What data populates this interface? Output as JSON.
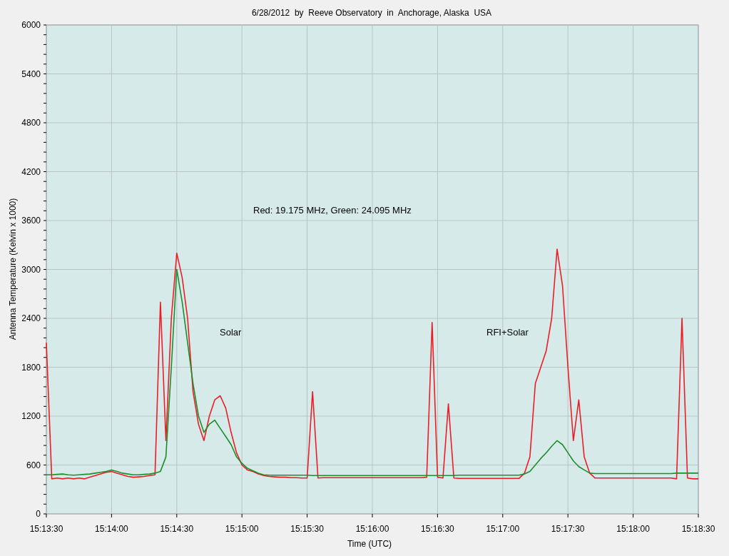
{
  "chart_data": {
    "type": "line",
    "grid": true,
    "title": "6/28/2012  by  Reeve Observatory  in  Anchorage, Alaska  USA",
    "xlabel": "Time (UTC)",
    "ylabel": "Antenna Temperature (Kelvin x 1000)",
    "categories": [
      "15:13:30",
      null,
      null,
      null,
      null,
      null,
      null,
      null,
      null,
      null,
      null,
      null,
      "15:14:00",
      null,
      null,
      null,
      null,
      null,
      null,
      null,
      null,
      null,
      null,
      null,
      "15:14:30",
      null,
      null,
      null,
      null,
      null,
      null,
      null,
      null,
      null,
      null,
      null,
      "15:15:00",
      null,
      null,
      null,
      null,
      null,
      null,
      null,
      null,
      null,
      null,
      null,
      "15:15:30",
      null,
      null,
      null,
      null,
      null,
      null,
      null,
      null,
      null,
      null,
      null,
      "15:16:00",
      null,
      null,
      null,
      null,
      null,
      null,
      null,
      null,
      null,
      null,
      null,
      "15:16:30",
      null,
      null,
      null,
      null,
      null,
      null,
      null,
      null,
      null,
      null,
      null,
      "15:17:00",
      null,
      null,
      null,
      null,
      null,
      null,
      null,
      null,
      null,
      null,
      null,
      "15:17:30",
      null,
      null,
      null,
      null,
      null,
      null,
      null,
      null,
      null,
      null,
      null,
      "15:18:00",
      null,
      null,
      null,
      null,
      null,
      null,
      null,
      null,
      null,
      null,
      null,
      "15:18:30"
    ],
    "series": [
      {
        "color": "#ee1c25",
        "values": [
          2100,
          430,
          440,
          430,
          440,
          430,
          440,
          430,
          450,
          470,
          490,
          510,
          520,
          500,
          480,
          460,
          450,
          455,
          460,
          470,
          480,
          2600,
          900,
          2400,
          3200,
          2900,
          2400,
          1500,
          1100,
          900,
          1200,
          1400,
          1450,
          1300,
          1000,
          750,
          600,
          540,
          520,
          490,
          470,
          460,
          455,
          450,
          450,
          445,
          445,
          440,
          440,
          1500,
          440,
          445,
          445,
          445,
          445,
          445,
          445,
          445,
          445,
          445,
          445,
          445,
          445,
          445,
          445,
          445,
          445,
          445,
          445,
          445,
          450,
          2350,
          450,
          440,
          1350,
          440,
          435,
          435,
          435,
          435,
          435,
          435,
          435,
          435,
          435,
          435,
          435,
          435,
          500,
          700,
          1600,
          1800,
          2000,
          2400,
          3250,
          2800,
          1800,
          900,
          1400,
          700,
          500,
          440,
          440,
          440,
          440,
          440,
          440,
          440,
          440,
          440,
          440,
          440,
          440,
          440,
          440,
          440,
          430,
          2400,
          440,
          430,
          430
        ]
      },
      {
        "color": "#1a8f2a",
        "values": [
          480,
          480,
          485,
          490,
          480,
          475,
          480,
          485,
          490,
          500,
          510,
          520,
          540,
          520,
          500,
          490,
          480,
          480,
          485,
          490,
          500,
          520,
          700,
          1800,
          3000,
          2600,
          2100,
          1600,
          1200,
          1000,
          1100,
          1150,
          1050,
          950,
          850,
          700,
          620,
          560,
          530,
          500,
          480,
          475,
          475,
          475,
          475,
          475,
          475,
          475,
          475,
          470,
          470,
          470,
          470,
          470,
          470,
          470,
          470,
          470,
          470,
          470,
          470,
          470,
          470,
          470,
          470,
          470,
          470,
          470,
          470,
          470,
          470,
          470,
          470,
          470,
          470,
          470,
          475,
          475,
          475,
          475,
          475,
          475,
          475,
          475,
          475,
          475,
          475,
          475,
          490,
          520,
          600,
          680,
          750,
          830,
          900,
          850,
          750,
          650,
          580,
          540,
          500,
          495,
          495,
          495,
          495,
          495,
          495,
          495,
          495,
          495,
          495,
          495,
          495,
          495,
          495,
          495,
          500,
          500,
          500,
          500,
          500
        ]
      }
    ],
    "ylim": [
      0,
      6000
    ],
    "yticks": [
      0,
      600,
      1200,
      1800,
      2400,
      3000,
      3600,
      4200,
      4800,
      5400,
      6000
    ],
    "annotations": [
      "Red: 19.175 MHz, Green: 24.095 MHz",
      "Solar",
      "RFI+Solar"
    ]
  }
}
